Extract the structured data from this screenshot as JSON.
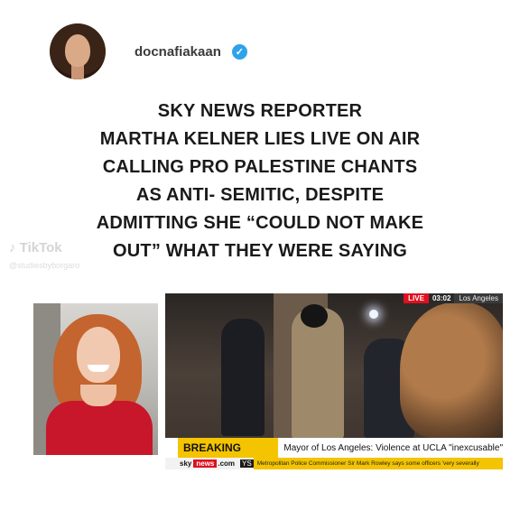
{
  "header": {
    "username": "docnafiakaan",
    "verified_icon": "verified-check-icon"
  },
  "headline": {
    "lines": [
      "SKY NEWS REPORTER",
      "MARTHA KELNER LIES LIVE ON AIR",
      "CALLING PRO PALESTINE CHANTS",
      "AS ANTI- SEMITIC, DESPITE",
      "ADMITTING SHE “COULD NOT MAKE",
      "OUT” WHAT THEY WERE SAYING"
    ]
  },
  "watermark": {
    "logo_text": "TikTok",
    "handle": "@studiesbyborgaro"
  },
  "news_frame": {
    "live_label": "LIVE",
    "time": "03:02",
    "location": "Los Angeles",
    "breaking_label": "BREAKING NEWS",
    "headline": "Mayor of Los Angeles: Violence at UCLA \"inexcusable\"",
    "brand_sky": "sky",
    "brand_news": "news",
    "brand_dotcom": ".com",
    "sep": "YS",
    "ticker_text": "Metropolitan Police Commissioner Sir Mark Rowley says some officers 'very severally"
  },
  "colors": {
    "verified": "#2fa3ea",
    "breaking": "#f4c400",
    "live": "#e0101e",
    "dress": "#c8162a"
  }
}
